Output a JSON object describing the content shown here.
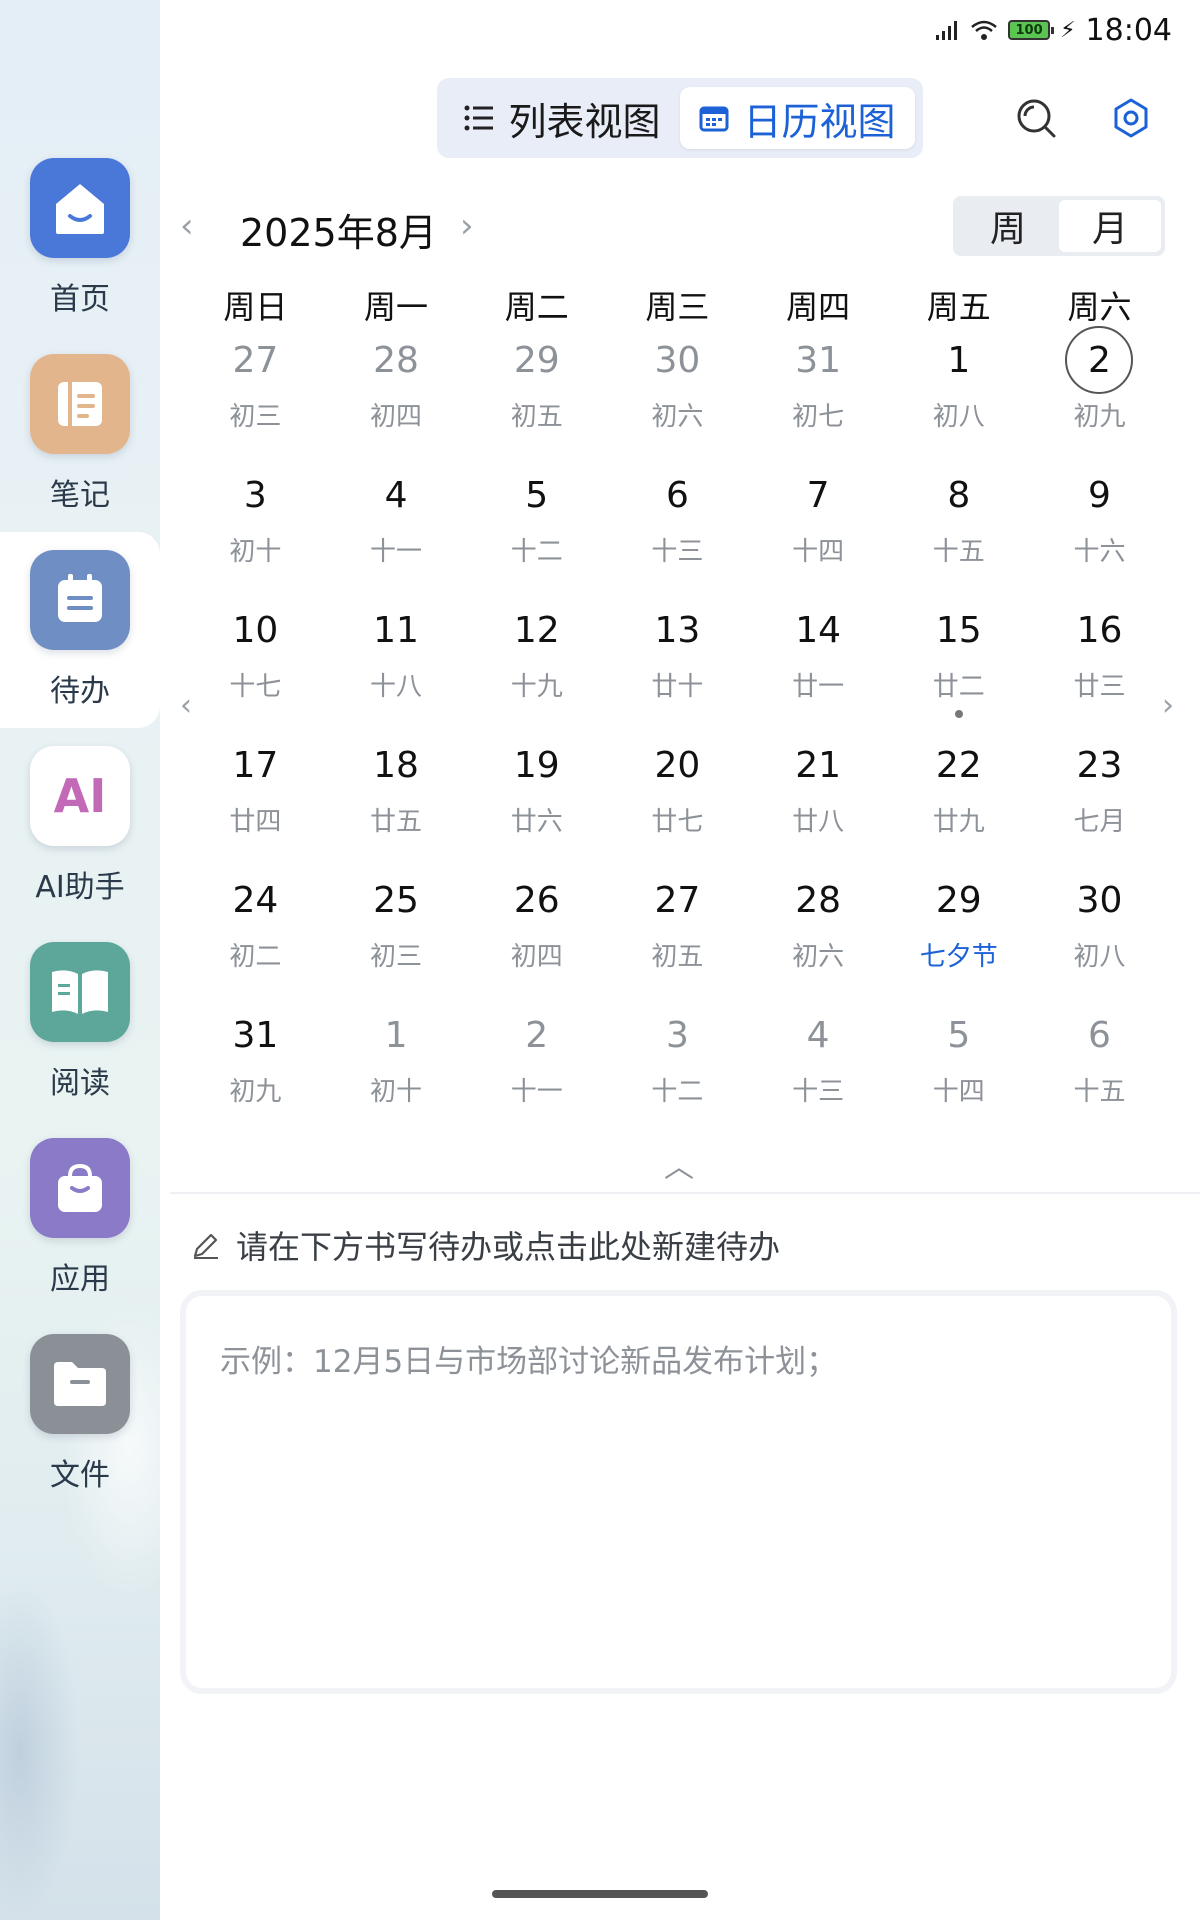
{
  "status_bar": {
    "battery": "100",
    "time": "18:04"
  },
  "sidebar": {
    "items": [
      {
        "label": "首页",
        "icon": "home-icon"
      },
      {
        "label": "笔记",
        "icon": "notebook-icon"
      },
      {
        "label": "待办",
        "icon": "calendar-todo-icon"
      },
      {
        "label": "AI助手",
        "icon": "ai-assistant-icon",
        "icon_text": "AI"
      },
      {
        "label": "阅读",
        "icon": "book-icon"
      },
      {
        "label": "应用",
        "icon": "bag-icon"
      },
      {
        "label": "文件",
        "icon": "folder-icon"
      }
    ],
    "active_index": 2
  },
  "view_toggle": {
    "list_label": "列表视图",
    "calendar_label": "日历视图",
    "active": "calendar"
  },
  "calendar": {
    "month_title": "2025年8月",
    "week_label": "周",
    "month_label": "月",
    "active_mode": "month",
    "weekdays": [
      "周日",
      "周一",
      "周二",
      "周三",
      "周四",
      "周五",
      "周六"
    ],
    "weeks": [
      [
        {
          "n": "27",
          "l": "初三",
          "m": true
        },
        {
          "n": "28",
          "l": "初四",
          "m": true
        },
        {
          "n": "29",
          "l": "初五",
          "m": true
        },
        {
          "n": "30",
          "l": "初六",
          "m": true
        },
        {
          "n": "31",
          "l": "初七",
          "m": true
        },
        {
          "n": "1",
          "l": "初八"
        },
        {
          "n": "2",
          "l": "初九",
          "today": true
        }
      ],
      [
        {
          "n": "3",
          "l": "初十"
        },
        {
          "n": "4",
          "l": "十一"
        },
        {
          "n": "5",
          "l": "十二"
        },
        {
          "n": "6",
          "l": "十三"
        },
        {
          "n": "7",
          "l": "十四"
        },
        {
          "n": "8",
          "l": "十五"
        },
        {
          "n": "9",
          "l": "十六"
        }
      ],
      [
        {
          "n": "10",
          "l": "十七"
        },
        {
          "n": "11",
          "l": "十八"
        },
        {
          "n": "12",
          "l": "十九"
        },
        {
          "n": "13",
          "l": "廿十"
        },
        {
          "n": "14",
          "l": "廿一"
        },
        {
          "n": "15",
          "l": "廿二",
          "dot": true
        },
        {
          "n": "16",
          "l": "廿三"
        }
      ],
      [
        {
          "n": "17",
          "l": "廿四"
        },
        {
          "n": "18",
          "l": "廿五"
        },
        {
          "n": "19",
          "l": "廿六"
        },
        {
          "n": "20",
          "l": "廿七"
        },
        {
          "n": "21",
          "l": "廿八"
        },
        {
          "n": "22",
          "l": "廿九"
        },
        {
          "n": "23",
          "l": "七月"
        }
      ],
      [
        {
          "n": "24",
          "l": "初二"
        },
        {
          "n": "25",
          "l": "初三"
        },
        {
          "n": "26",
          "l": "初四"
        },
        {
          "n": "27",
          "l": "初五"
        },
        {
          "n": "28",
          "l": "初六"
        },
        {
          "n": "29",
          "l": "七夕节",
          "festival": true
        },
        {
          "n": "30",
          "l": "初八"
        }
      ],
      [
        {
          "n": "31",
          "l": "初九"
        },
        {
          "n": "1",
          "l": "初十",
          "m": true
        },
        {
          "n": "2",
          "l": "十一",
          "m": true
        },
        {
          "n": "3",
          "l": "十二",
          "m": true
        },
        {
          "n": "4",
          "l": "十三",
          "m": true
        },
        {
          "n": "5",
          "l": "十四",
          "m": true
        },
        {
          "n": "6",
          "l": "十五",
          "m": true
        }
      ]
    ]
  },
  "todo": {
    "hint": "请在下方书写待办或点击此处新建待办",
    "placeholder": "示例：12月5日与市场部讨论新品发布计划；"
  },
  "colors": {
    "accent": "#1c62d6",
    "muted": "#8d9299"
  }
}
